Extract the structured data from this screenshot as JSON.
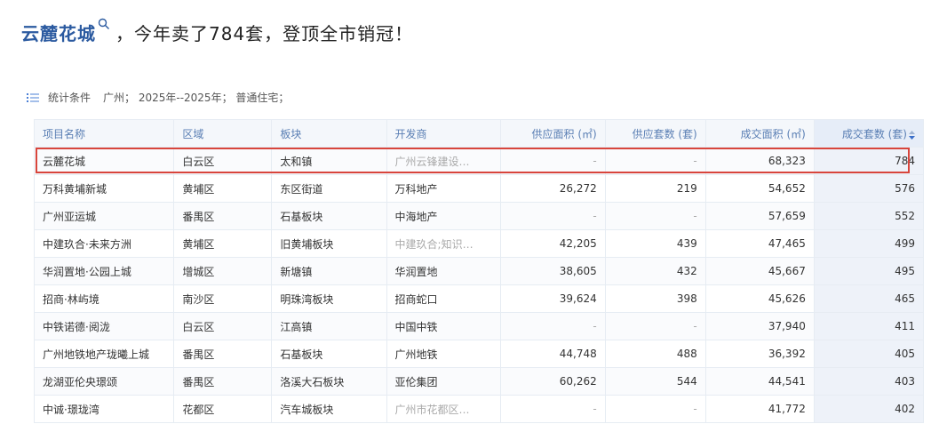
{
  "headline": {
    "link_text": "云麓花城",
    "rest": "，今年卖了784套，登顶全市销冠！"
  },
  "filter": {
    "label": "统计条件",
    "text": "广州；  2025年--2025年；  普通住宅；"
  },
  "table": {
    "headers": [
      "项目名称",
      "区域",
      "板块",
      "开发商",
      "供应面积 (㎡)",
      "供应套数 (套)",
      "成交面积 (㎡)",
      "成交套数 (套)"
    ],
    "rows": [
      [
        "云麓花城",
        "白云区",
        "太和镇",
        "广州云锋建设…",
        "-",
        "-",
        "68,323",
        "784"
      ],
      [
        "万科黄埔新城",
        "黄埔区",
        "东区街道",
        "万科地产",
        "26,272",
        "219",
        "54,652",
        "576"
      ],
      [
        "广州亚运城",
        "番禺区",
        "石基板块",
        "中海地产",
        "-",
        "-",
        "57,659",
        "552"
      ],
      [
        "中建玖合·未来方洲",
        "黄埔区",
        "旧黄埔板块",
        "中建玖合;知识…",
        "42,205",
        "439",
        "47,465",
        "499"
      ],
      [
        "华润置地·公园上城",
        "增城区",
        "新塘镇",
        "华润置地",
        "38,605",
        "432",
        "45,667",
        "495"
      ],
      [
        "招商·林屿境",
        "南沙区",
        "明珠湾板块",
        "招商蛇口",
        "39,624",
        "398",
        "45,626",
        "465"
      ],
      [
        "中铁诺德·阅泷",
        "白云区",
        "江高镇",
        "中国中铁",
        "-",
        "-",
        "37,940",
        "411"
      ],
      [
        "广州地铁地产珑曦上城",
        "番禺区",
        "石基板块",
        "广州地铁",
        "44,748",
        "488",
        "36,392",
        "405"
      ],
      [
        "龙湖亚伦央璟颂",
        "番禺区",
        "洛溪大石板块",
        "亚伦集团",
        "60,262",
        "544",
        "44,541",
        "403"
      ],
      [
        "中诚·璟珑湾",
        "花都区",
        "汽车城板块",
        "广州市花都区…",
        "-",
        "-",
        "41,772",
        "402"
      ]
    ]
  },
  "colors": {
    "link": "#2b5aa0",
    "header_text": "#5a7fb4",
    "highlight": "#d8453c"
  },
  "icons": [
    "search-icon",
    "list-icon",
    "sort-icon"
  ]
}
